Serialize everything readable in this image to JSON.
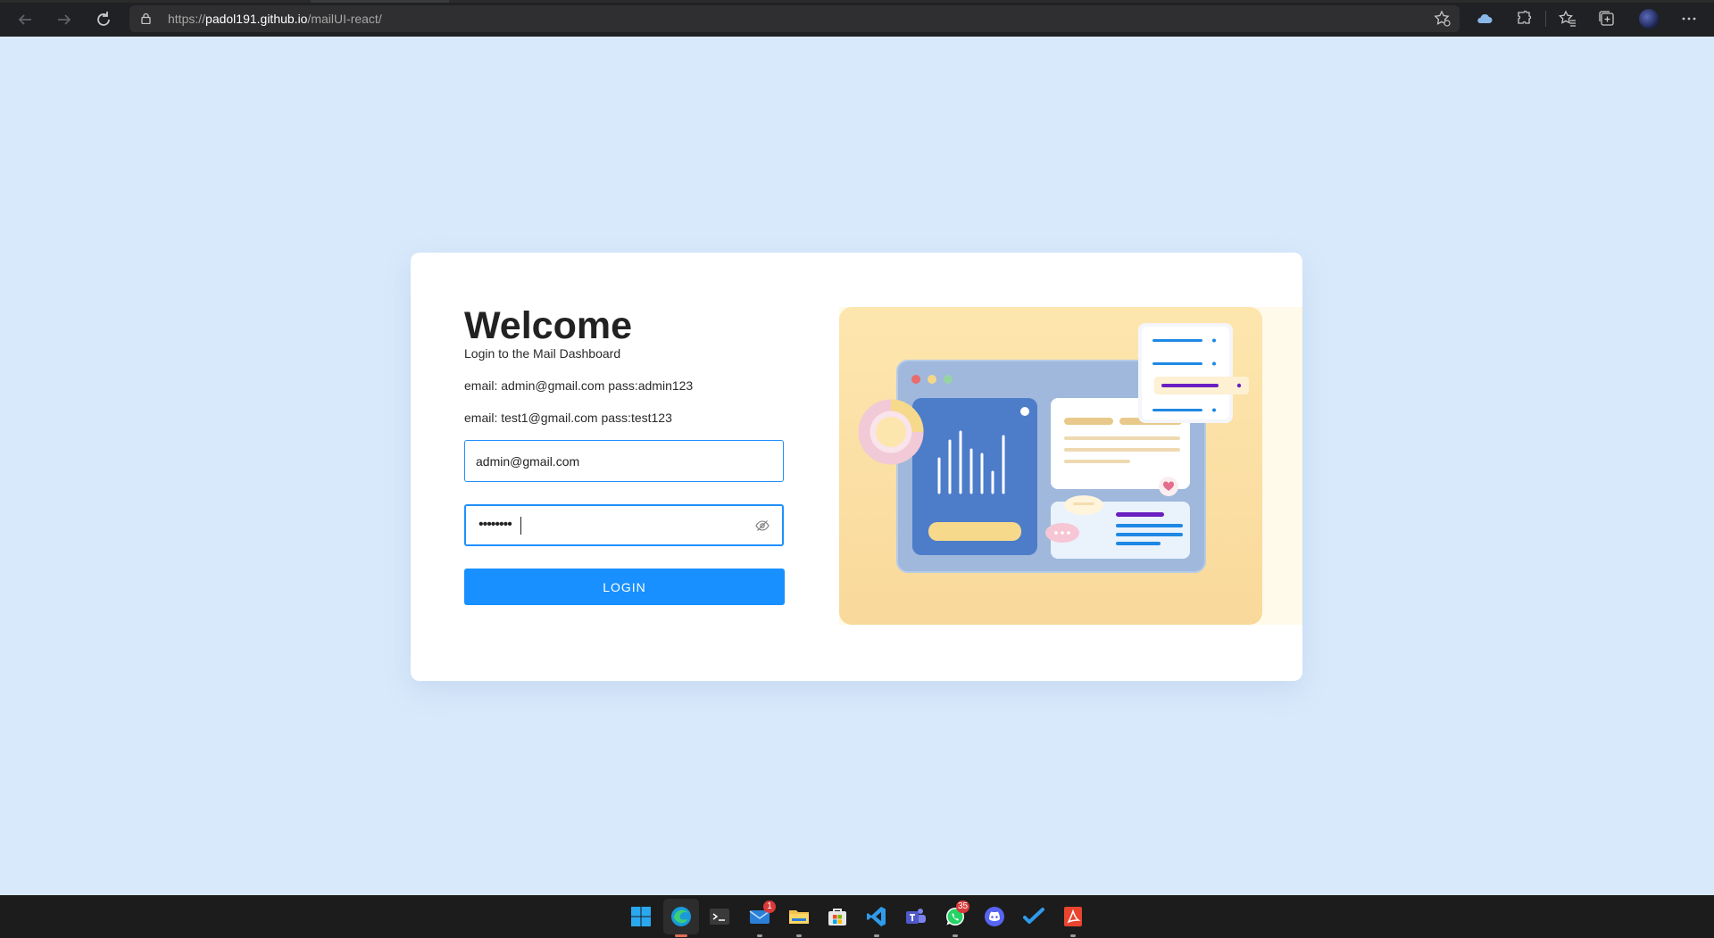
{
  "browser": {
    "url_scheme": "https://",
    "url_host": "padol191.github.io",
    "url_path": "/mailUI-react/",
    "icons": [
      "back-icon",
      "forward-icon",
      "refresh-icon",
      "lock-icon",
      "add-favorite-icon",
      "cloud-icon",
      "extensions-icon",
      "favorites-icon",
      "collections-icon",
      "profile-avatar",
      "more-icon"
    ]
  },
  "login": {
    "title": "Welcome",
    "subtitle": "Login to the Mail Dashboard",
    "hint_admin": "email: admin@gmail.com pass:admin123",
    "hint_test": "email: test1@gmail.com pass:test123",
    "email_value": "admin@gmail.com",
    "password_mask": "••••••••",
    "button_label": "LOGIN"
  },
  "colors": {
    "page_bg": "#d8e9fb",
    "accent": "#1890ff",
    "illustration_bg": "#fde6ae"
  },
  "taskbar": {
    "apps": [
      "windows-start-icon",
      "edge-icon",
      "terminal-icon",
      "mail-icon",
      "file-explorer-icon",
      "store-icon",
      "vscode-icon",
      "teams-icon",
      "whatsapp-icon",
      "discord-icon",
      "todo-icon",
      "acrobat-icon"
    ],
    "mail_badge": "1",
    "whatsapp_badge": "35"
  }
}
